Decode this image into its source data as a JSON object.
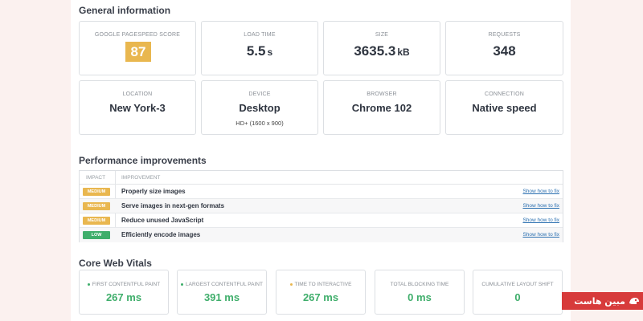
{
  "general": {
    "title": "General information",
    "cards": {
      "pagespeed": {
        "label": "GOOGLE PAGESPEED SCORE",
        "value": "87"
      },
      "load_time": {
        "label": "LOAD TIME",
        "value": "5.5",
        "unit": "s"
      },
      "size": {
        "label": "SIZE",
        "value": "3635.3",
        "unit": "kB"
      },
      "requests": {
        "label": "REQUESTS",
        "value": "348"
      },
      "location": {
        "label": "LOCATION",
        "value": "New York-3"
      },
      "device": {
        "label": "DEVICE",
        "value": "Desktop",
        "sub": "HD+ (1600 x 900)"
      },
      "browser": {
        "label": "BROWSER",
        "value": "Chrome 102"
      },
      "connection": {
        "label": "CONNECTION",
        "value": "Native speed"
      }
    }
  },
  "performance": {
    "title": "Performance improvements",
    "headers": {
      "impact": "IMPACT",
      "improvement": "IMPROVEMENT"
    },
    "rows": [
      {
        "impact": "MEDIUM",
        "text": "Properly size images",
        "link": "Show how to fix"
      },
      {
        "impact": "MEDIUM",
        "text": "Serve images in next-gen formats",
        "link": "Show how to fix"
      },
      {
        "impact": "MEDIUM",
        "text": "Reduce unused JavaScript",
        "link": "Show how to fix"
      },
      {
        "impact": "LOW",
        "text": "Efficiently encode images",
        "link": "Show how to fix"
      }
    ]
  },
  "vitals": {
    "title": "Core Web Vitals",
    "items": [
      {
        "label": "FIRST CONTENTFUL PAINT",
        "value": "267 ms"
      },
      {
        "label": "LARGEST CONTENTFUL PAINT",
        "value": "391 ms"
      },
      {
        "label": "TIME TO INTERACTIVE",
        "value": "267 ms"
      },
      {
        "label": "TOTAL BLOCKING TIME",
        "value": "0 ms"
      },
      {
        "label": "CUMULATIVE LAYOUT SHIFT",
        "value": "0"
      }
    ]
  },
  "colors": {
    "medium": "#e9b74f",
    "low": "#3fae6b",
    "good": "#3fae6b",
    "link": "#2a6fb0",
    "logo_bg": "#d73b3b"
  },
  "logo": {
    "text": "مبین هاست",
    "icon": "mobinhost-logo-icon"
  }
}
